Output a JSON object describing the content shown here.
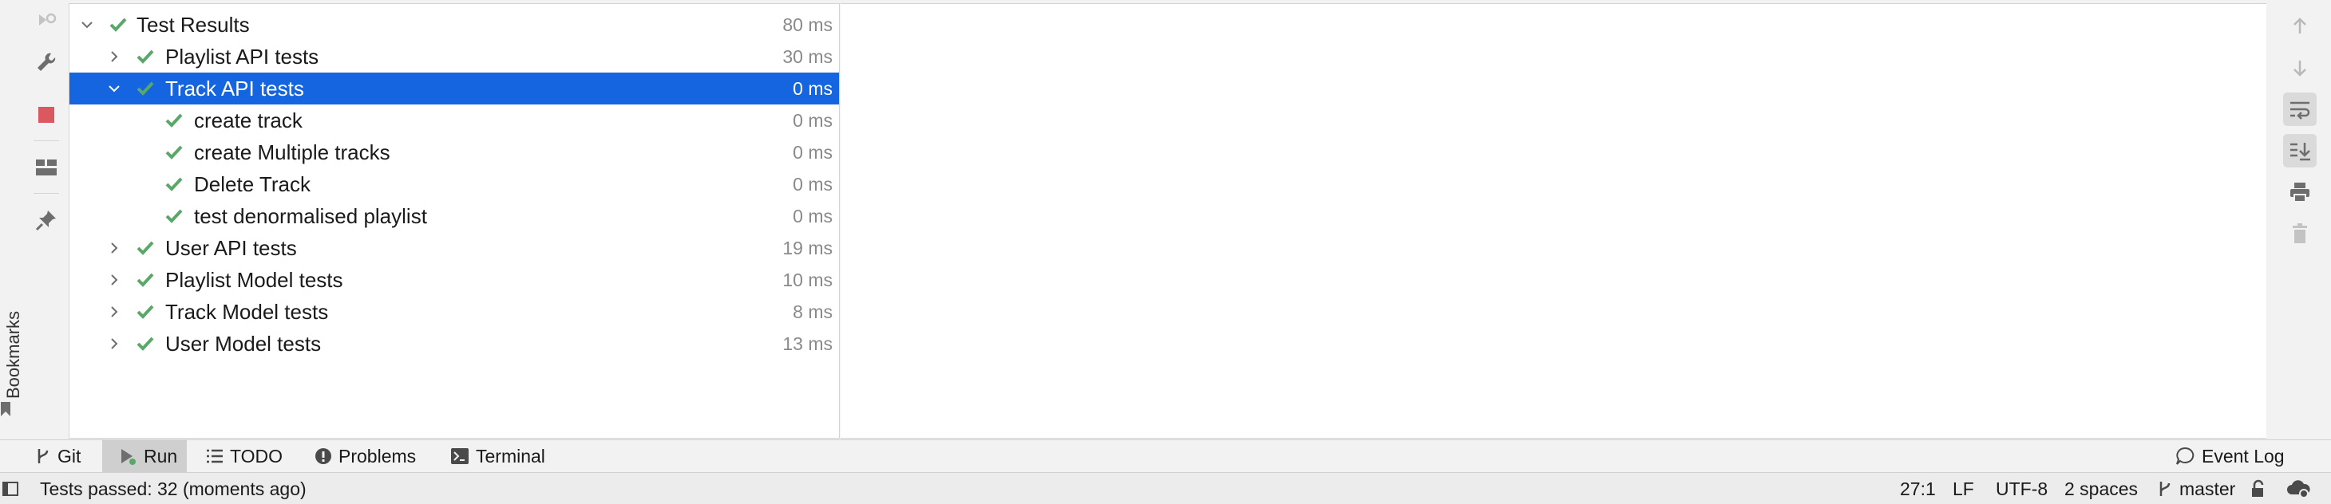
{
  "bookmarks_strip": {
    "label": "Bookmarks"
  },
  "left_toolbar": {
    "icons": [
      "rerun-icon",
      "settings-wrench-icon",
      "stop-icon",
      "layout-icon",
      "pin-icon"
    ]
  },
  "test_tree": {
    "rows": [
      {
        "label": "Test Results",
        "time": "80 ms",
        "level": 0,
        "expanded": true,
        "status": "passed"
      },
      {
        "label": "Playlist API tests",
        "time": "30 ms",
        "level": 1,
        "expanded": false,
        "status": "passed"
      },
      {
        "label": "Track API tests",
        "time": "0 ms",
        "level": 1,
        "expanded": true,
        "status": "passed",
        "selected": true
      },
      {
        "label": "create track",
        "time": "0 ms",
        "level": 2,
        "status": "passed"
      },
      {
        "label": "create Multiple tracks",
        "time": "0 ms",
        "level": 2,
        "status": "passed"
      },
      {
        "label": "Delete Track",
        "time": "0 ms",
        "level": 2,
        "status": "passed"
      },
      {
        "label": "test denormalised playlist",
        "time": "0 ms",
        "level": 2,
        "status": "passed"
      },
      {
        "label": "User API tests",
        "time": "19 ms",
        "level": 1,
        "expanded": false,
        "status": "passed"
      },
      {
        "label": "Playlist Model tests",
        "time": "10 ms",
        "level": 1,
        "expanded": false,
        "status": "passed"
      },
      {
        "label": "Track Model tests",
        "time": "8 ms",
        "level": 1,
        "expanded": false,
        "status": "passed"
      },
      {
        "label": "User Model tests",
        "time": "13 ms",
        "level": 1,
        "expanded": false,
        "status": "passed"
      }
    ]
  },
  "right_toolbar": {
    "icons": [
      "arrow-up-icon",
      "arrow-down-icon",
      "soft-wrap-icon",
      "scroll-to-end-icon",
      "print-icon",
      "trash-icon"
    ]
  },
  "tool_tabs": {
    "git": "Git",
    "run": "Run",
    "todo": "TODO",
    "problems": "Problems",
    "terminal": "Terminal",
    "event_log": "Event Log"
  },
  "status_bar": {
    "message": "Tests passed: 32 (moments ago)",
    "position": "27:1",
    "line_separator": "LF",
    "encoding": "UTF-8",
    "indent": "2 spaces",
    "branch": "master"
  },
  "colors": {
    "selection": "#1565e0",
    "check": "#59a869",
    "stop": "#db5860"
  }
}
